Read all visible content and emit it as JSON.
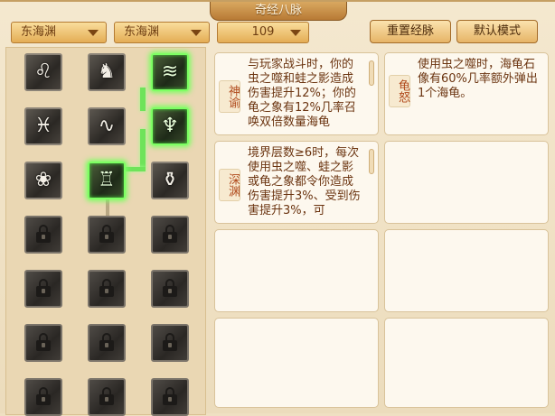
{
  "window": {
    "title": "奇经八脉"
  },
  "dropdowns": [
    {
      "value": "东海渊"
    },
    {
      "value": "东海渊"
    },
    {
      "value": "109"
    }
  ],
  "buttons": {
    "reset": "重置经脉",
    "default_mode": "默认模式"
  },
  "skills": {
    "col1": [
      "lion-head",
      "koi-fish",
      "lotus"
    ],
    "col2": [
      "warrior-figure",
      "wave-swirl",
      "bowl-vessel"
    ],
    "col3": [
      "flowing-waves",
      "dragon-wing",
      "jade-crest"
    ]
  },
  "cards": [
    {
      "tag": "神谕",
      "text": "与玩家战斗时，你的虫之噬和蛙之影造成伤害提升12%；你的龟之象有12%几率召唤双倍数量海龟"
    },
    {
      "tag": "龟怒",
      "text": "使用虫之噬时，海龟石像有60%几率额外弹出1个海龟。"
    },
    {
      "tag": "深渊",
      "text": "境界层数≥6时，每次使用虫之噬、蛙之影或龟之象都令你造成伤害提升3%、受到伤害提升3%，可"
    }
  ]
}
